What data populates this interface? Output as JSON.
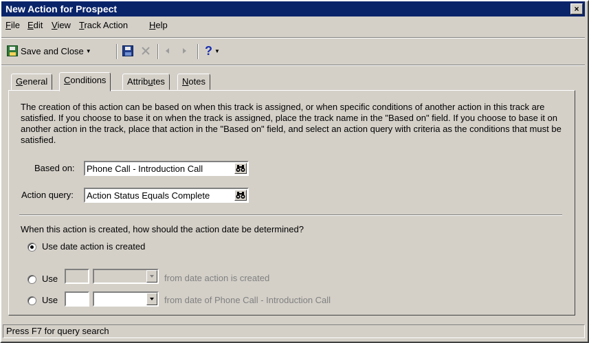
{
  "window": {
    "title": "New Action for Prospect",
    "close_glyph": "×"
  },
  "menu": [
    {
      "label": "File",
      "accel": "F",
      "rest": "ile"
    },
    {
      "label": "Edit",
      "accel": "E",
      "rest": "dit"
    },
    {
      "label": "View",
      "accel": "V",
      "rest": "iew"
    },
    {
      "label": "Track Action",
      "accel": "T",
      "rest": "rack Action"
    },
    {
      "label": "Help",
      "accel": "H",
      "rest": "elp"
    }
  ],
  "toolbar": {
    "save_close_label": "Save and Close",
    "help_glyph": "?",
    "icons": [
      "save-close-icon",
      "save-icon",
      "delete-icon",
      "previous-icon",
      "next-icon",
      "help-icon"
    ]
  },
  "tabs": [
    {
      "label": "General",
      "accel": "G",
      "rest": "eneral"
    },
    {
      "label": "Conditions",
      "accel": "C",
      "rest": "onditions",
      "active": true
    },
    {
      "label": "Attributes",
      "pre": "Attrib",
      "accel": "u",
      "rest": "tes"
    },
    {
      "label": "Notes",
      "accel": "N",
      "rest": "otes"
    }
  ],
  "conditions": {
    "description": "The creation of this action can be based on when this track is assigned, or when specific conditions of another action in this track are satisfied. If you choose to base it on when the track is assigned, place the track name in the \"Based on\" field. If you choose to base it on another action in the track, place that action in the \"Based on\" field, and select an action query with criteria as the conditions that must be satisfied.",
    "based_on_label": "Based on:",
    "based_on_value": "Phone Call - Introduction Call",
    "action_query_label": "Action query:",
    "action_query_value": "Action Status Equals Complete",
    "date_question": "When this action is created, how should the action date be determined?",
    "option1_label": "Use date action is created",
    "option2_label": "Use",
    "option2_suffix": "from date action is created",
    "option3_label": "Use",
    "option3_suffix": "from date of Phone Call - Introduction Call",
    "selected_option": 1
  },
  "status_bar": {
    "text": "Press F7 for query search"
  }
}
